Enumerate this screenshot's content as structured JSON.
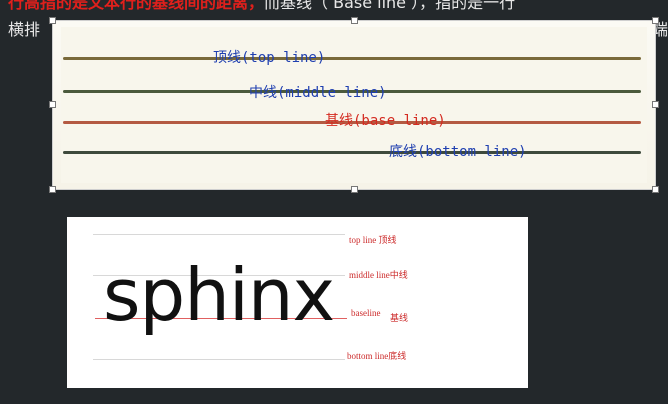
{
  "header": {
    "line1_red": "行高指的是文本行的基线间的距离，",
    "line1_rest": "而基线（ Base line ），指的是一行",
    "line2": "横排",
    "line2_right": "端"
  },
  "figure1": {
    "top_line": "顶线(top line)",
    "middle_line": "中线(middle line)",
    "base_line": "基线(base line)",
    "bottom_line": "底线(bottom line)",
    "colors": {
      "blue": "#1f3fb0",
      "red": "#d42a20"
    }
  },
  "figure2": {
    "word": "sphinx",
    "top_line": "top line 顶线",
    "middle_line": "middle line中线",
    "baseline": "baseline",
    "baseline_cn": "基线",
    "bottom_line": "bottom line底线"
  }
}
